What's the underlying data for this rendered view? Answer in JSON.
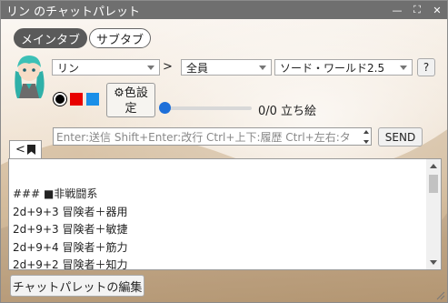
{
  "window": {
    "title": "リン のチャットパレット",
    "controls": {
      "minimize": "—",
      "maximize": "⛶",
      "close": "✕"
    }
  },
  "tabs": [
    {
      "label": "メインタブ",
      "active": true
    },
    {
      "label": "サブタブ",
      "active": false
    }
  ],
  "character_select": {
    "value": "リン"
  },
  "separator": ">",
  "target_select": {
    "value": "全員"
  },
  "system_select": {
    "value": "ソード・ワールド2.5"
  },
  "help_button": {
    "label": "?"
  },
  "colors": {
    "swatches": [
      "#000000",
      "#e80000",
      "#1a8fe8"
    ],
    "accent": "#1e6fd9",
    "titlebar": "#6f6f6f"
  },
  "color_settings_button": {
    "icon": "gear-icon",
    "label_line1": "⚙色設",
    "label_line2": "定"
  },
  "standing_image": {
    "current": 0,
    "total": 0,
    "text": "0/0 立ち絵"
  },
  "chat_input": {
    "placeholder": "Enter:送信 Shift+Enter:改行 Ctrl+上下:履歴 Ctrl+左右:タ",
    "value": ""
  },
  "send_button": {
    "label": "SEND"
  },
  "collapse_tab": {
    "label": "<",
    "icon": "bookmark-icon"
  },
  "palette": {
    "lines": [
      "",
      "### ■非戦闘系",
      "2d+9+3 冒険者＋器用",
      "2d+9+3 冒険者＋敏捷",
      "2d+9+4 冒険者＋筋力",
      "2d+9+2 冒険者＋知力"
    ]
  },
  "edit_button": {
    "label": "チャットパレットの編集"
  }
}
